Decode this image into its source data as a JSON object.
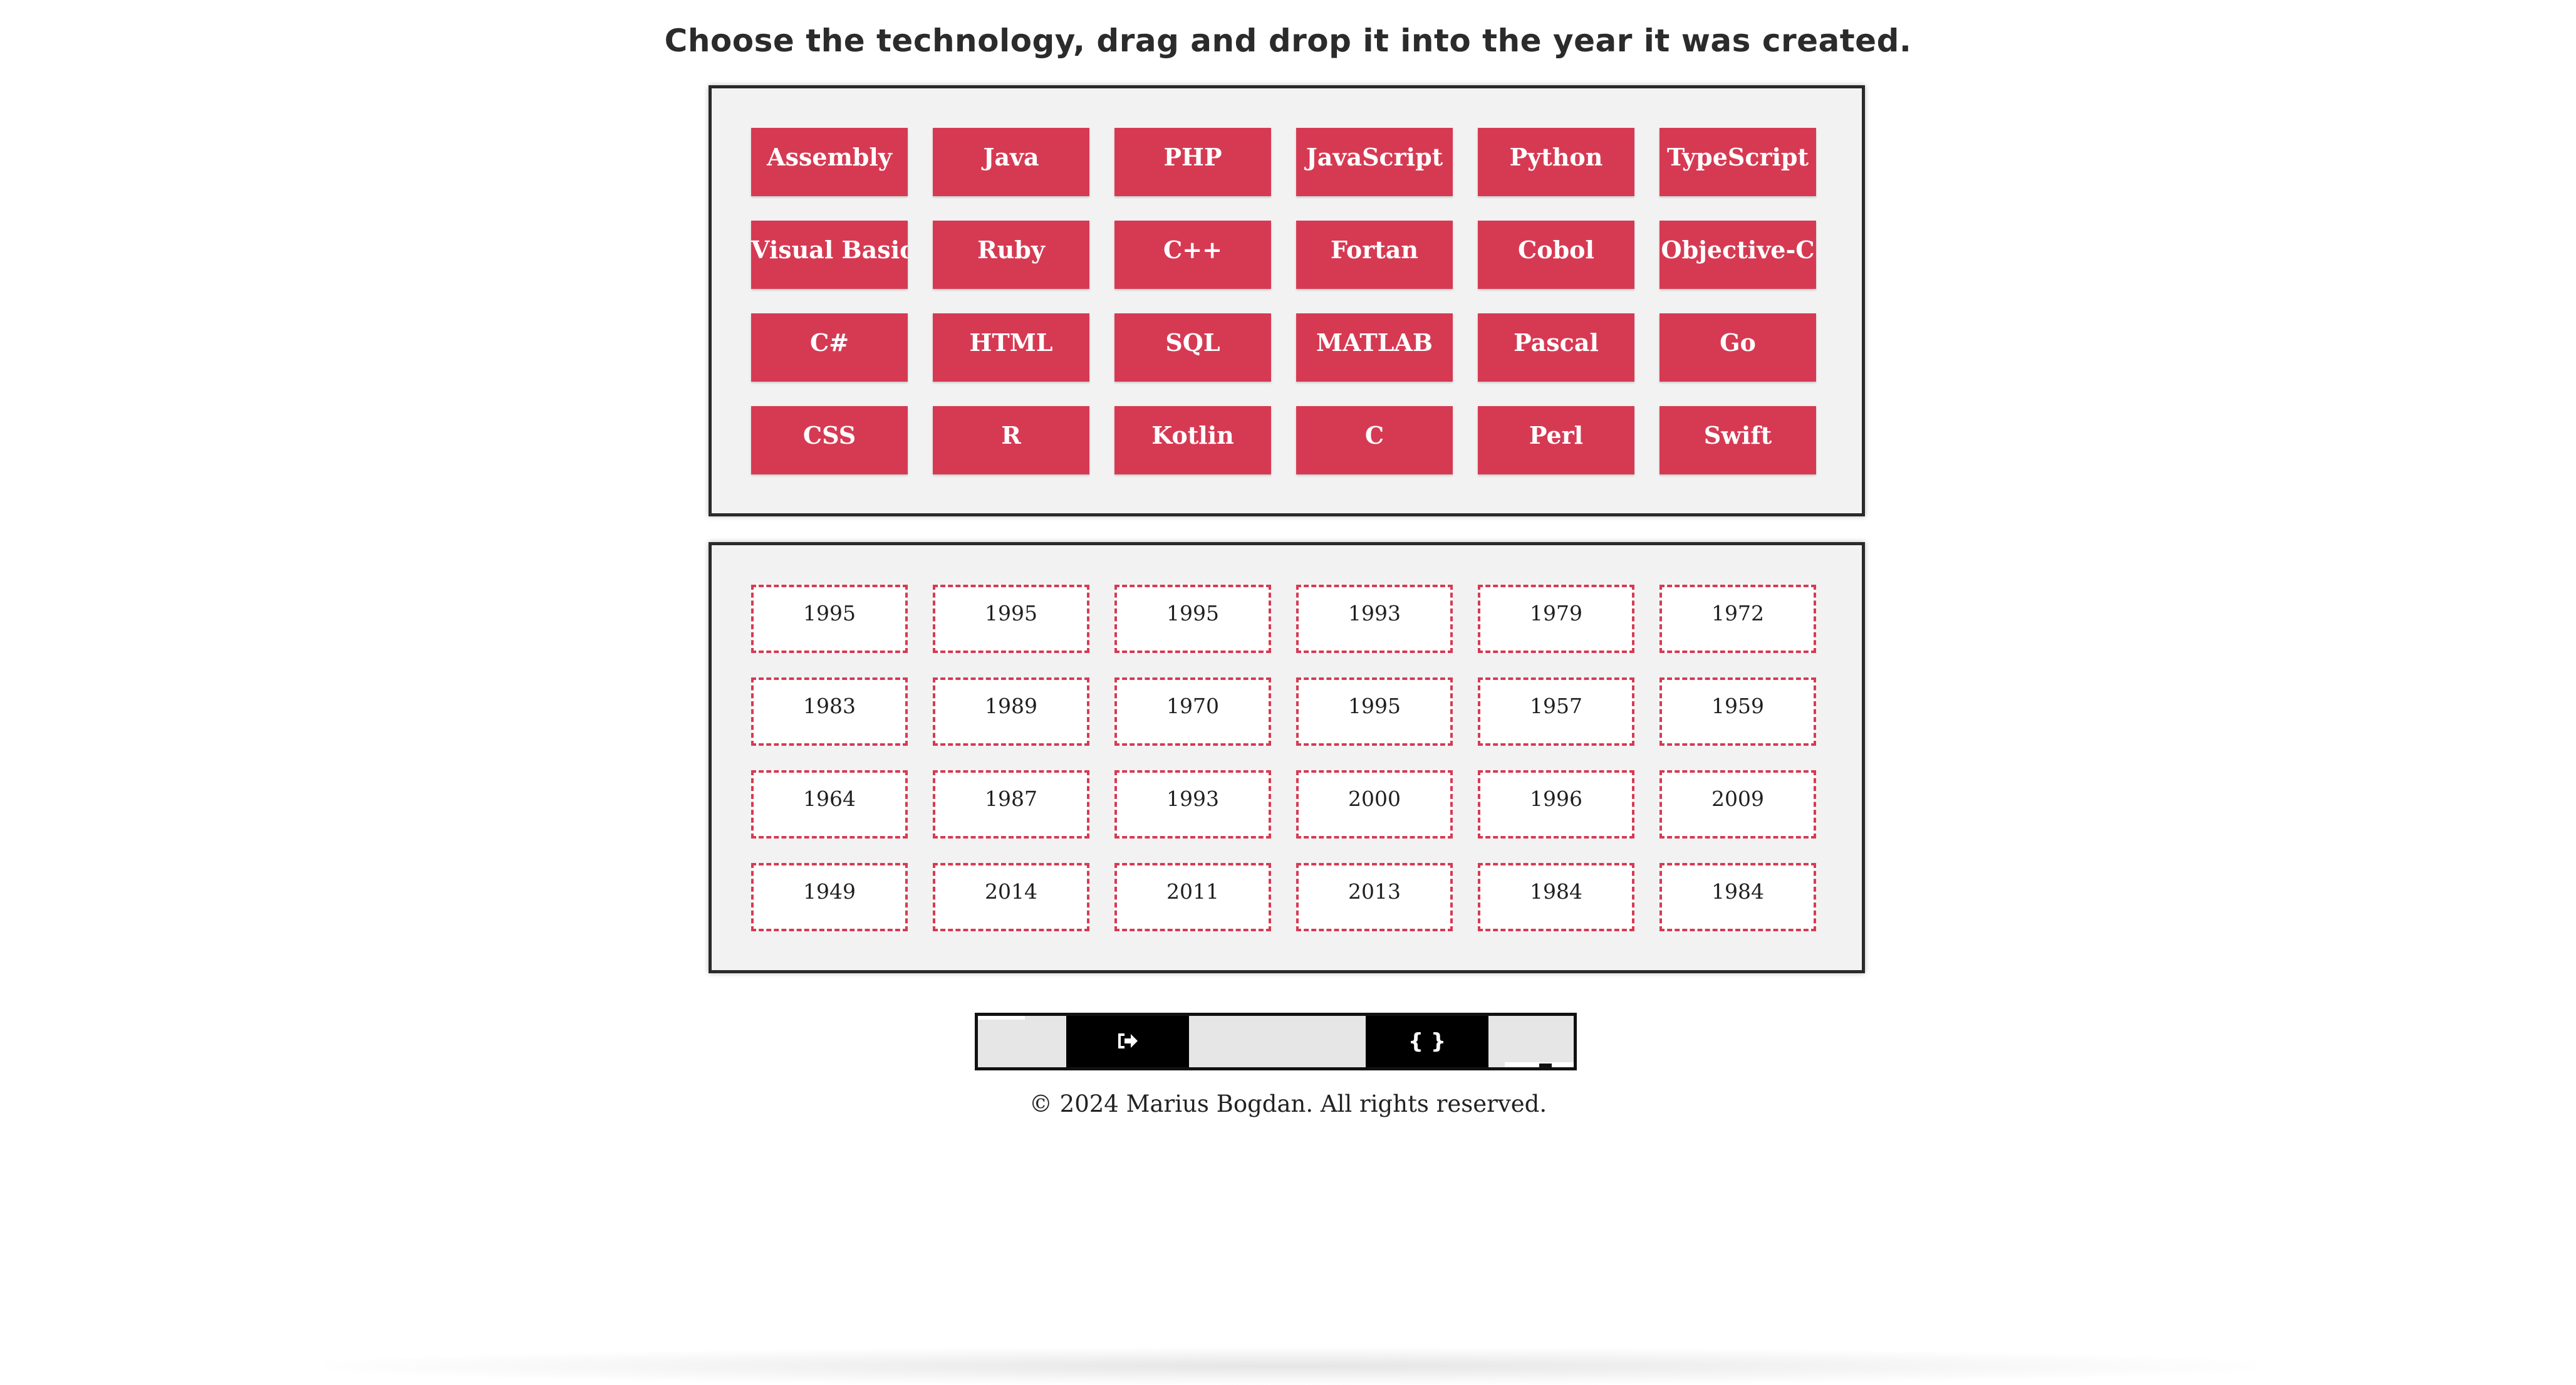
{
  "header": {
    "title": "Choose the technology, drag and drop it into the year it was created."
  },
  "technologies": [
    "Assembly",
    "Java",
    "PHP",
    "JavaScript",
    "Python",
    "TypeScript",
    "Visual Basic",
    "Ruby",
    "C++",
    "Fortan",
    "Cobol",
    "Objective-C",
    "C#",
    "HTML",
    "SQL",
    "MATLAB",
    "Pascal",
    "Go",
    "CSS",
    "R",
    "Kotlin",
    "C",
    "Perl",
    "Swift"
  ],
  "years": [
    "1995",
    "1995",
    "1995",
    "1993",
    "1979",
    "1972",
    "1983",
    "1989",
    "1970",
    "1995",
    "1957",
    "1959",
    "1964",
    "1987",
    "1993",
    "2000",
    "1996",
    "2009",
    "1949",
    "2014",
    "2011",
    "2013",
    "1984",
    "1984"
  ],
  "toolbar": {
    "exit_icon": "sign-out-icon",
    "code_label": "{ }",
    "code_icon": "code-braces-icon"
  },
  "footer": {
    "copyright": "© 2024 Marius Bogdan. All rights reserved."
  },
  "colors": {
    "tech_tile": "#d63a53",
    "slot_border": "#d63a53",
    "panel_bg": "#f2f2f2",
    "panel_border": "#2a2a2a",
    "toolbar_button": "#000000"
  }
}
